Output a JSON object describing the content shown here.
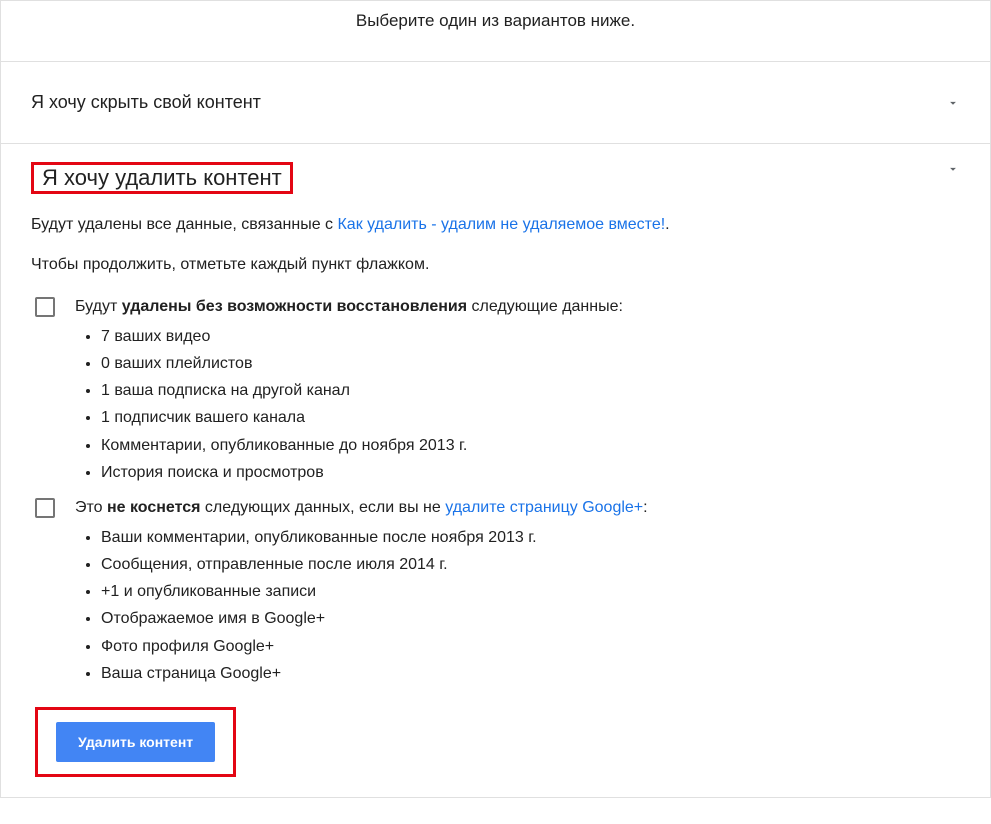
{
  "topInstruction": "Выберите один из вариантов ниже.",
  "accordion": {
    "hideContent": {
      "title": "Я хочу скрыть свой контент"
    },
    "deleteContent": {
      "title": "Я хочу удалить контент",
      "descriptionPrefix": "Будут удалены все данные, связанные с ",
      "descriptionLink": "Как удалить - удалим не удаляемое вместе!",
      "descriptionSuffix": ".",
      "continueText": "Чтобы продолжить, отметьте каждый пункт флажком.",
      "checkbox1": {
        "prefix": "Будут ",
        "bold": "удалены без возможности восстановления",
        "suffix": " следующие данные:",
        "items": [
          "7 ваших видео",
          "0 ваших плейлистов",
          "1 ваша подписка на другой канал",
          "1 подписчик вашего канала",
          "Комментарии, опубликованные до ноября 2013 г.",
          "История поиска и просмотров"
        ]
      },
      "checkbox2": {
        "prefix": "Это ",
        "bold": "не коснется",
        "suffix1": " следующих данных, если вы не ",
        "link": "удалите страницу Google+",
        "suffix2": ":",
        "items": [
          "Ваши комментарии, опубликованные после ноября 2013 г.",
          "Сообщения, отправленные после июля 2014 г.",
          "+1 и опубликованные записи",
          "Отображаемое имя в Google+",
          "Фото профиля Google+",
          "Ваша страница Google+"
        ]
      },
      "deleteButton": "Удалить контент"
    }
  }
}
